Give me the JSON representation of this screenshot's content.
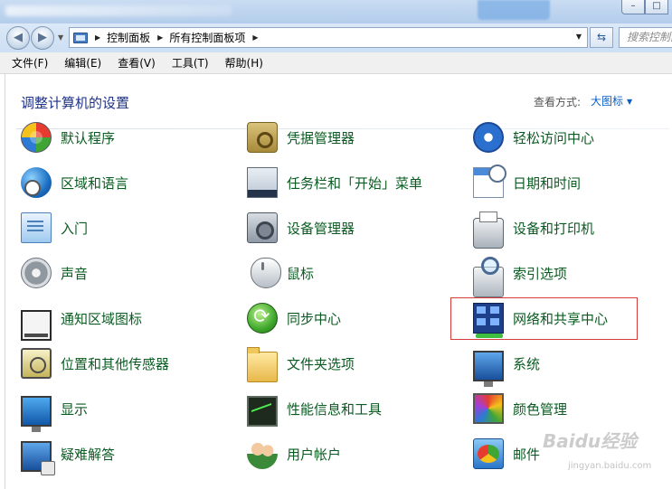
{
  "window": {
    "controls": [
      "–",
      "□"
    ]
  },
  "address_bar": {
    "crumbs": [
      "控制面板",
      "所有控制面板项"
    ],
    "search_placeholder": "搜索控制面"
  },
  "menu": [
    "文件(F)",
    "编辑(E)",
    "查看(V)",
    "工具(T)",
    "帮助(H)"
  ],
  "header": {
    "title": "调整计算机的设置",
    "view_by_label": "查看方式:",
    "view_by_value": "大图标"
  },
  "items": [
    {
      "label": "默认程序",
      "icon": "default-programs-icon"
    },
    {
      "label": "凭据管理器",
      "icon": "credential-manager-icon"
    },
    {
      "label": "轻松访问中心",
      "icon": "ease-of-access-icon"
    },
    {
      "label": "区域和语言",
      "icon": "region-language-icon"
    },
    {
      "label": "任务栏和「开始」菜单",
      "icon": "taskbar-start-menu-icon"
    },
    {
      "label": "日期和时间",
      "icon": "date-time-icon"
    },
    {
      "label": "入门",
      "icon": "getting-started-icon"
    },
    {
      "label": "设备管理器",
      "icon": "device-manager-icon"
    },
    {
      "label": "设备和打印机",
      "icon": "devices-printers-icon"
    },
    {
      "label": "声音",
      "icon": "sound-icon"
    },
    {
      "label": "鼠标",
      "icon": "mouse-icon"
    },
    {
      "label": "索引选项",
      "icon": "indexing-options-icon"
    },
    {
      "label": "通知区域图标",
      "icon": "notification-area-icon"
    },
    {
      "label": "同步中心",
      "icon": "sync-center-icon"
    },
    {
      "label": "网络和共享中心",
      "icon": "network-sharing-icon"
    },
    {
      "label": "位置和其他传感器",
      "icon": "location-sensors-icon"
    },
    {
      "label": "文件夹选项",
      "icon": "folder-options-icon"
    },
    {
      "label": "系统",
      "icon": "system-icon"
    },
    {
      "label": "显示",
      "icon": "display-icon"
    },
    {
      "label": "性能信息和工具",
      "icon": "performance-icon"
    },
    {
      "label": "颜色管理",
      "icon": "color-management-icon"
    },
    {
      "label": "疑难解答",
      "icon": "troubleshooting-icon"
    },
    {
      "label": "用户帐户",
      "icon": "user-accounts-icon"
    },
    {
      "label": "邮件",
      "icon": "mail-icon"
    }
  ],
  "colors": {
    "link_text": "#0a5b21",
    "heading": "#1e3287",
    "highlight_border": "#d43b3b"
  },
  "watermark": {
    "text": "Baidu经验",
    "sub": "jingyan.baidu.com"
  }
}
